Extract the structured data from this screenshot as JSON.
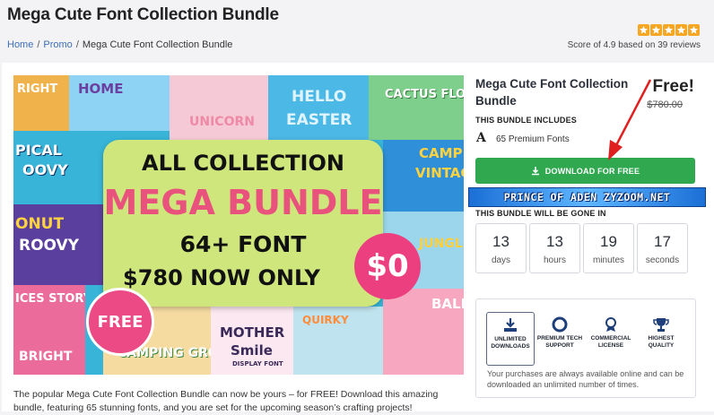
{
  "page": {
    "title": "Mega Cute Font Collection Bundle",
    "breadcrumb": [
      {
        "label": "Home"
      },
      {
        "label": "Promo"
      },
      {
        "label": "Mega Cute Font Collection Bundle"
      }
    ],
    "rating": {
      "stars": 5,
      "score_text": "Score of 4.9 based on 39 reviews"
    }
  },
  "hero": {
    "box_line1": "ALL COLLECTION",
    "box_line2": "MEGA BUNDLE",
    "box_line3": "64+ FONT",
    "box_line4": "$780 NOW ONLY",
    "zero_badge": "$0",
    "free_badge": "FREE",
    "tiles": [
      {
        "text": "RIGHT"
      },
      {
        "text": "HOME"
      },
      {
        "text": "UNICORN"
      },
      {
        "text": "HELLO"
      },
      {
        "text": "EASTER"
      },
      {
        "text": "CACTUS FLOR"
      },
      {
        "text": "PICAL"
      },
      {
        "text": "OOVY"
      },
      {
        "text": "CAMP"
      },
      {
        "text": "VINTAG"
      },
      {
        "text": "ONUT"
      },
      {
        "text": "ROOVY"
      },
      {
        "text": "JUNGLE"
      },
      {
        "text": "ICES STORY"
      },
      {
        "text": "BALLO"
      },
      {
        "text": "MOTHER"
      },
      {
        "text": "Smile"
      },
      {
        "text": "QUIRKY"
      },
      {
        "text": "CAMPING GROUND"
      },
      {
        "text": "BRIGHT"
      },
      {
        "text": "DISPLAY FONT"
      }
    ]
  },
  "sidebar": {
    "bundle_name": "Mega Cute Font Collection Bundle",
    "price": "Free!",
    "old_price": "$780.00",
    "includes_label": "THIS BUNDLE INCLUDES",
    "includes_icon": "A",
    "includes_text": "65 Premium Fonts",
    "download_label": "DOWNLOAD FOR FREE",
    "banner_text": "PRINCE OF ADEN ZYZOOM.NET",
    "gone_label": "THIS BUNDLE WILL BE GONE IN",
    "countdown": [
      {
        "value": "13",
        "unit": "days"
      },
      {
        "value": "13",
        "unit": "hours"
      },
      {
        "value": "19",
        "unit": "minutes"
      },
      {
        "value": "17",
        "unit": "seconds"
      }
    ],
    "features": [
      {
        "label": "UNLIMITED DOWNLOADS",
        "icon": "download-icon"
      },
      {
        "label": "PREMIUM TECH SUPPORT",
        "icon": "lifebuoy-icon"
      },
      {
        "label": "COMMERCIAL LICENSE",
        "icon": "medal-icon"
      },
      {
        "label": "HIGHEST QUALITY",
        "icon": "trophy-icon"
      }
    ],
    "features_note": "Your purchases are always available online and can be downloaded an unlimited number of times."
  },
  "description": "The popular Mega Cute Font Collection Bundle can now be yours – for FREE! Download this amazing bundle, featuring 65 stunning fonts, and you are set for the upcoming season’s crafting projects!",
  "colors": {
    "download_button": "#2fa84f",
    "star": "#f5a623",
    "promo_box": "#cfe67d",
    "accent_pink": "#e8527d",
    "arrow": "#e02020"
  }
}
